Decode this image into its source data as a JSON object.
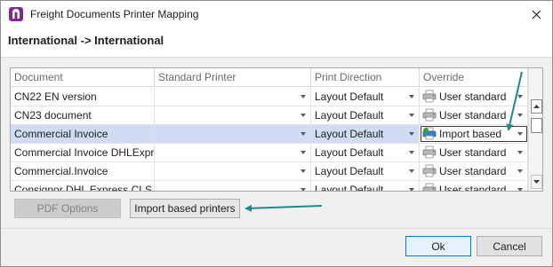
{
  "window": {
    "title": "Freight Documents Printer Mapping",
    "close_symbol": "✕"
  },
  "header": {
    "title": "International -> International"
  },
  "grid": {
    "columns": [
      "Document",
      "Standard Printer",
      "Print Direction",
      "Override"
    ],
    "rows": [
      {
        "document": "CN22 EN version",
        "standard_printer": "",
        "print_direction": "Layout Default",
        "override": "User standard",
        "override_icon": "printer-icon",
        "selected": false,
        "boxed": false
      },
      {
        "document": "CN23 document",
        "standard_printer": "",
        "print_direction": "Layout Default",
        "override": "User standard",
        "override_icon": "printer-icon",
        "selected": false,
        "boxed": false
      },
      {
        "document": "Commercial Invoice",
        "standard_printer": "",
        "print_direction": "Layout Default",
        "override": "Import based",
        "override_icon": "import-printer-icon",
        "selected": true,
        "boxed": true
      },
      {
        "document": "Commercial Invoice DHLExpre...",
        "standard_printer": "",
        "print_direction": "Layout Default",
        "override": "User standard",
        "override_icon": "printer-icon",
        "selected": false,
        "boxed": false
      },
      {
        "document": "Commercial.Invoice",
        "standard_printer": "",
        "print_direction": "Layout Default",
        "override": "User standard",
        "override_icon": "printer-icon",
        "selected": false,
        "boxed": false
      },
      {
        "document": "Consignor DHL Express CLS L...",
        "standard_printer": "",
        "print_direction": "Layout Default",
        "override": "User standard",
        "override_icon": "printer-icon",
        "selected": false,
        "boxed": false
      }
    ]
  },
  "buttons": {
    "pdf_options": "PDF Options",
    "import_based_printers": "Import based printers",
    "ok": "Ok",
    "cancel": "Cancel"
  },
  "colors": {
    "accent": "#0078d7",
    "annotation_arrow": "#1f8a86",
    "selected_row": "#cfdcf3"
  }
}
